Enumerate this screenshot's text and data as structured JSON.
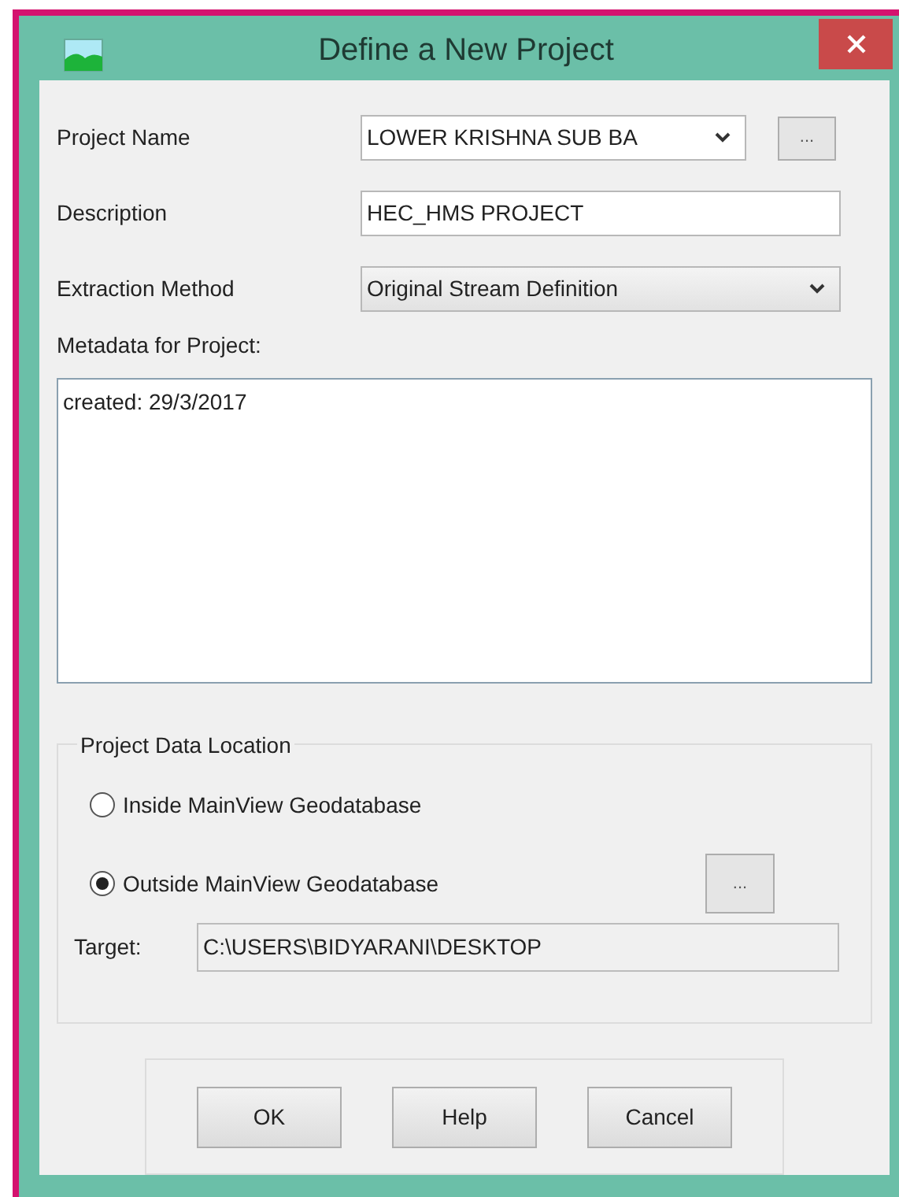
{
  "window": {
    "title": "Define a New Project"
  },
  "fields": [
    {
      "kind": "combo",
      "label": "Project Name",
      "value": "LOWER KRISHNA SUB BA",
      "browse": "..."
    },
    {
      "kind": "text",
      "label": "Description",
      "value": "HEC_HMS PROJECT"
    },
    {
      "kind": "combo",
      "label": "Extraction Method",
      "value": "Original Stream Definition"
    }
  ],
  "metadata": {
    "label": "Metadata for Project:",
    "value": "created: 29/3/2017"
  },
  "location": {
    "title": "Project Data Location",
    "options": [
      {
        "label": "Inside MainView Geodatabase",
        "selected": false
      },
      {
        "label": "Outside MainView Geodatabase",
        "selected": true
      }
    ],
    "browse": "...",
    "target_label": "Target:",
    "target": "C:\\USERS\\BIDYARANI\\DESKTOP"
  },
  "buttons": [
    "OK",
    "Help",
    "Cancel"
  ]
}
